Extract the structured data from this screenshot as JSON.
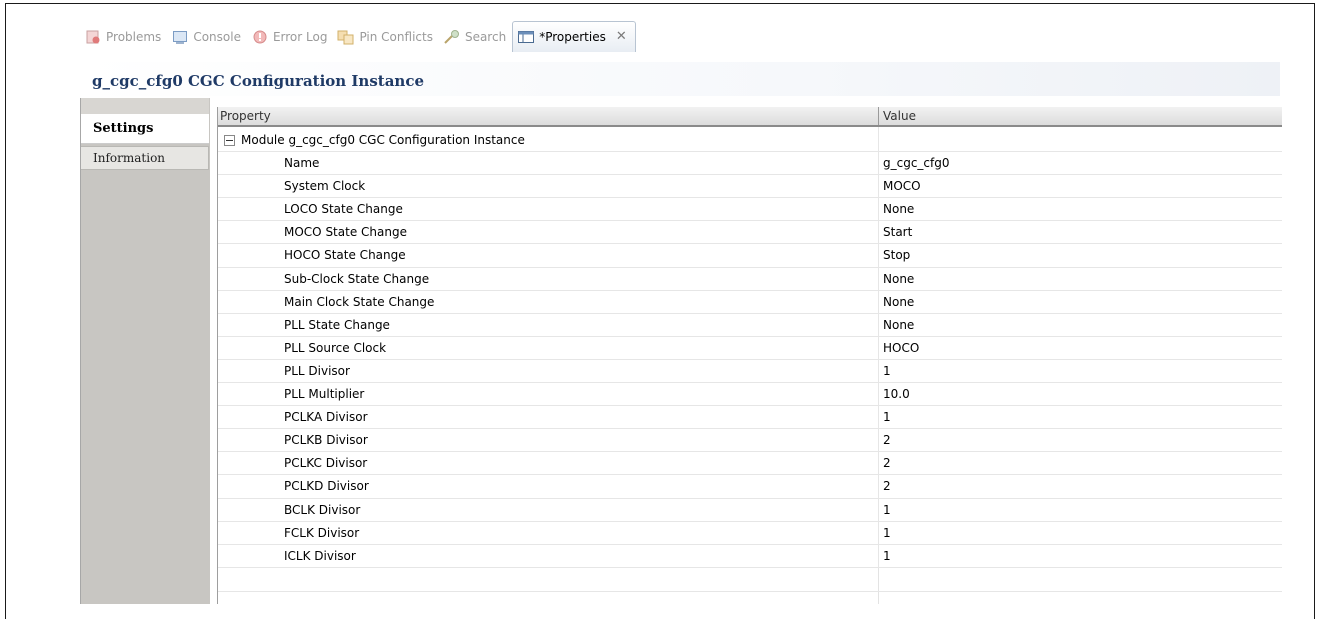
{
  "tabs": [
    {
      "label": "Problems",
      "icon": "problems-icon"
    },
    {
      "label": "Console",
      "icon": "console-icon"
    },
    {
      "label": "Error Log",
      "icon": "error-log-icon"
    },
    {
      "label": "Pin Conflicts",
      "icon": "pin-conflicts-icon"
    },
    {
      "label": "Search",
      "icon": "search-icon"
    },
    {
      "label": "*Properties",
      "icon": "properties-icon",
      "active": true
    }
  ],
  "title": "g_cgc_cfg0 CGC Configuration Instance",
  "side_tabs": {
    "settings": "Settings",
    "information": "Information"
  },
  "table": {
    "headers": {
      "property": "Property",
      "value": "Value"
    },
    "module_label": "Module g_cgc_cfg0 CGC Configuration Instance",
    "rows": [
      {
        "property": "Name",
        "value": "g_cgc_cfg0"
      },
      {
        "property": "System Clock",
        "value": "MOCO"
      },
      {
        "property": "LOCO State Change",
        "value": "None"
      },
      {
        "property": "MOCO State Change",
        "value": "Start"
      },
      {
        "property": "HOCO State Change",
        "value": "Stop"
      },
      {
        "property": "Sub-Clock State Change",
        "value": "None"
      },
      {
        "property": "Main Clock State Change",
        "value": "None"
      },
      {
        "property": "PLL State Change",
        "value": "None"
      },
      {
        "property": "PLL Source Clock",
        "value": "HOCO"
      },
      {
        "property": "PLL Divisor",
        "value": "1"
      },
      {
        "property": "PLL Multiplier",
        "value": "10.0"
      },
      {
        "property": "PCLKA Divisor",
        "value": "1"
      },
      {
        "property": "PCLKB Divisor",
        "value": "2"
      },
      {
        "property": "PCLKC Divisor",
        "value": "2"
      },
      {
        "property": "PCLKD Divisor",
        "value": "2"
      },
      {
        "property": "BCLK Divisor",
        "value": "1"
      },
      {
        "property": "FCLK Divisor",
        "value": "1"
      },
      {
        "property": "ICLK Divisor",
        "value": "1"
      }
    ]
  },
  "colors": {
    "title": "#1f3a66",
    "sidebar": "#c8c6c2"
  }
}
